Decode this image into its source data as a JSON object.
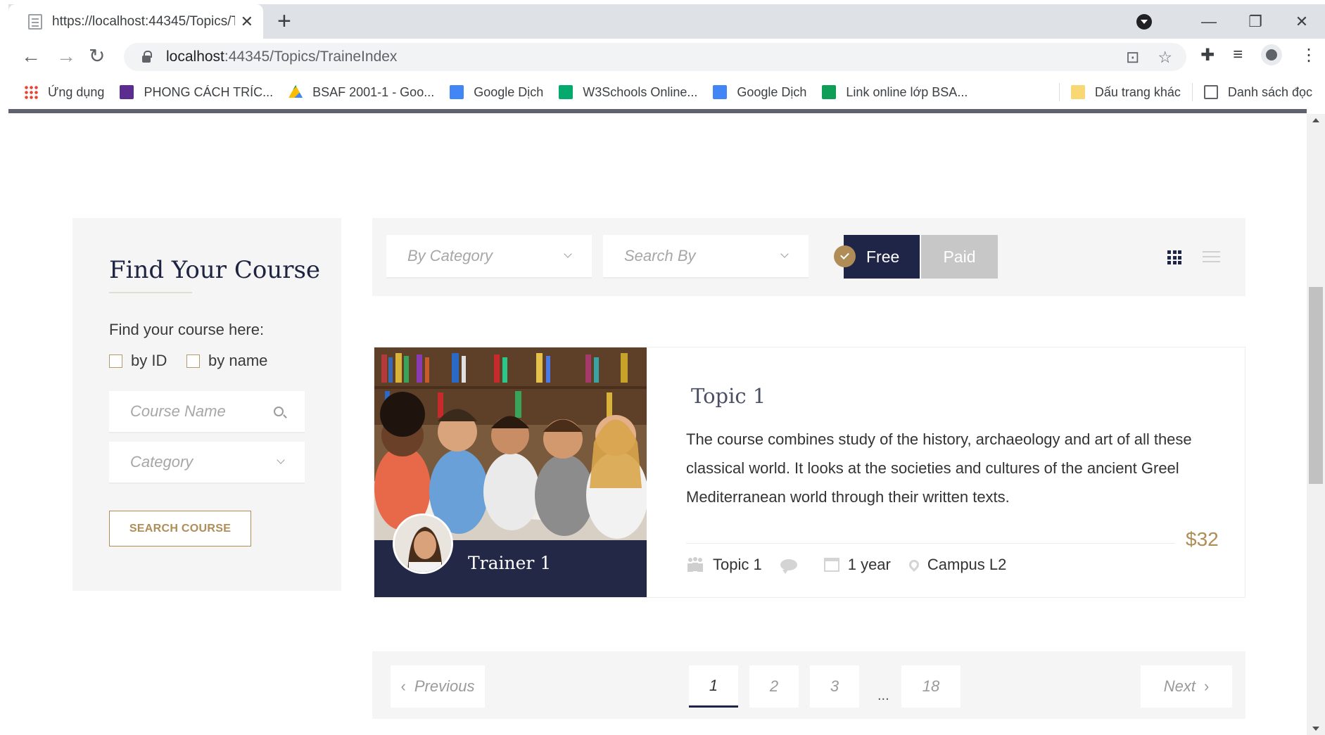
{
  "browser": {
    "tab_title": "https://localhost:44345/Topics/Tr...",
    "tab_close": "✕",
    "new_tab": "+",
    "window_min": "—",
    "window_restore": "❐",
    "window_close": "✕",
    "back": "←",
    "forward": "→",
    "reload": "↻",
    "url_host": "localhost",
    "url_rest": ":44345/Topics/TraineIndex",
    "bookmarks": [
      {
        "label": "Ứng dụng",
        "color": "#ea4335"
      },
      {
        "label": "PHONG CÁCH TRÍC...",
        "color": "#5b2d8e"
      },
      {
        "label": "BSAF 2001-1 - Goo...",
        "color": "#fbbc04"
      },
      {
        "label": "Google Dịch",
        "color": "#4285f4"
      },
      {
        "label": "W3Schools Online...",
        "color": "#04aa6d"
      },
      {
        "label": "Google Dịch",
        "color": "#4285f4"
      },
      {
        "label": "Link online lớp BSA...",
        "color": "#0f9d58"
      }
    ],
    "bookmarks_other": "Dấu trang khác",
    "reading_list": "Danh sách đọc"
  },
  "sidebar": {
    "title": "Find Your Course",
    "subtitle": "Find your course here:",
    "by_id_label": "by ID",
    "by_name_label": "by name",
    "course_name_placeholder": "Course Name",
    "category_placeholder": "Category",
    "search_button": "SEARCH COURSE"
  },
  "filters": {
    "by_category": "By Category",
    "search_by": "Search By",
    "free_label": "Free",
    "paid_label": "Paid"
  },
  "course": {
    "title": "Topic 1",
    "description": "The course combines study of the history, archaeology and art of all these classical world. It looks at the societies and cultures of the ancient Greel Mediterranean world through their written texts.",
    "trainer": "Trainer 1",
    "price": "$32",
    "meta_topic": "Topic 1",
    "meta_duration": "1 year",
    "meta_location": "Campus L2"
  },
  "pagination": {
    "previous": "Previous",
    "next": "Next",
    "pages": [
      "1",
      "2",
      "3"
    ],
    "ellipsis": "...",
    "last_page": "18",
    "current": "1"
  },
  "colors": {
    "navy": "#1f2546",
    "gold": "#b08d57",
    "panel_bg": "#f5f5f5"
  }
}
